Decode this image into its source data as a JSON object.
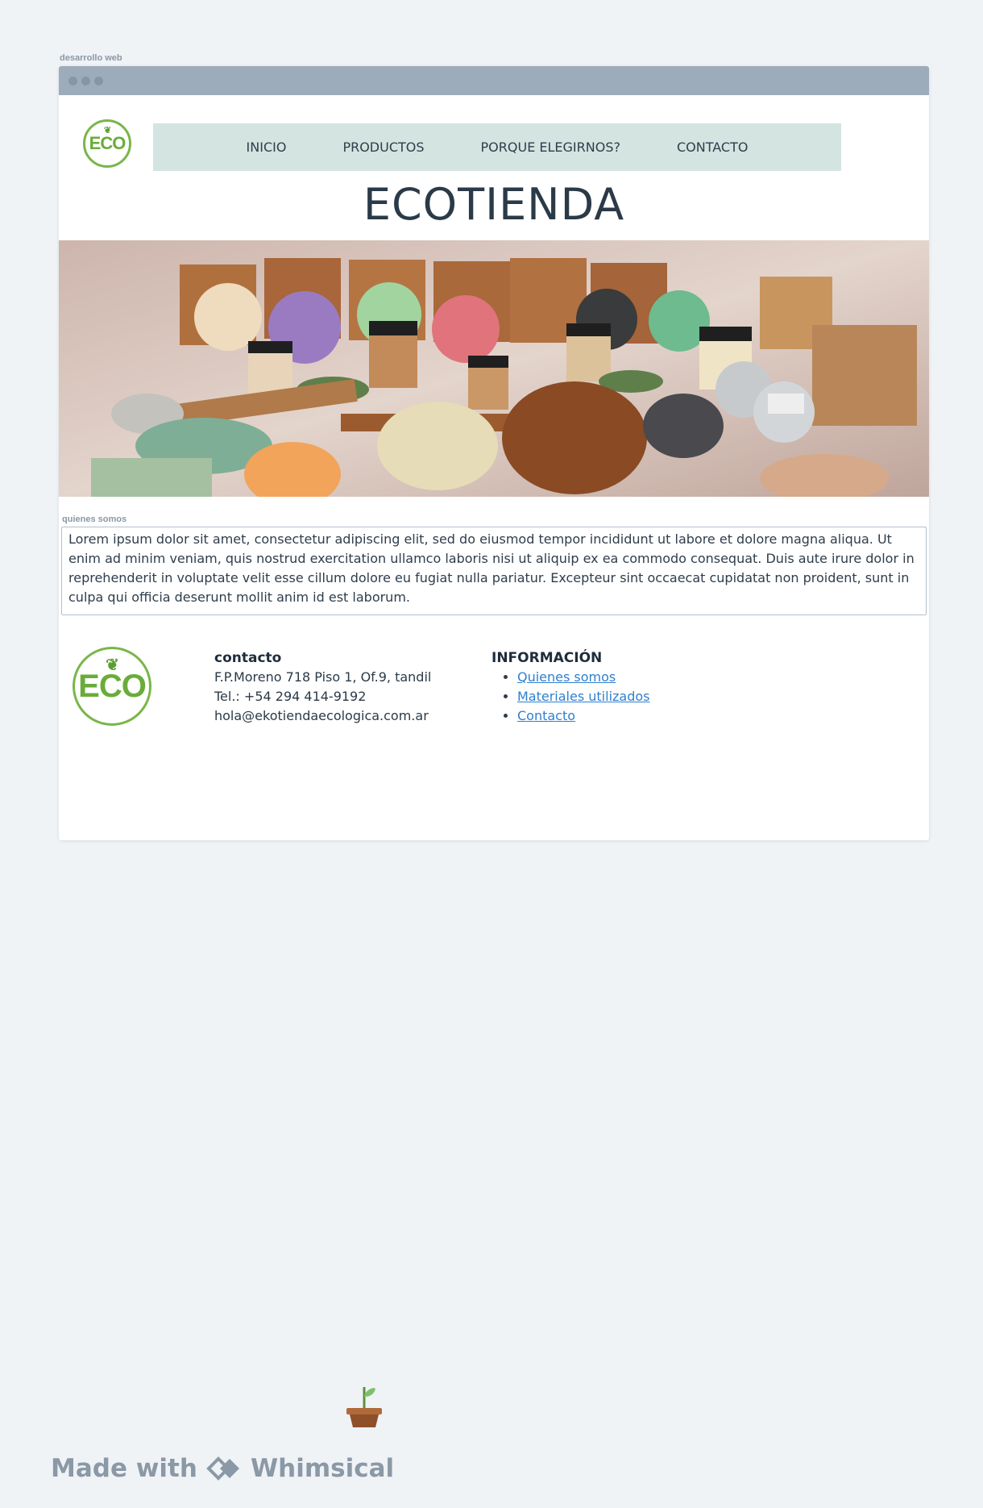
{
  "frame": {
    "label": "desarrollo web"
  },
  "header": {
    "logo_text": "ECO",
    "nav": [
      "INICIO",
      "PRODUCTOS",
      "PORQUE ELEGIRNOS?",
      "CONTACTO"
    ],
    "title": "ECOTIENDA"
  },
  "about": {
    "label": "quienes somos",
    "text": "Lorem ipsum dolor sit amet, consectetur adipiscing elit, sed do eiusmod tempor incididunt ut labore et dolore magna aliqua. Ut enim ad minim veniam, quis nostrud exercitation ullamco laboris nisi ut aliquip ex ea commodo consequat. Duis aute irure dolor in reprehenderit in voluptate velit esse cillum dolore eu fugiat nulla pariatur. Excepteur sint occaecat cupidatat non proident, sunt in culpa qui officia deserunt mollit anim id est laborum."
  },
  "footer": {
    "logo_text": "ECO",
    "contact": {
      "title": "contacto",
      "address": "F.P.Moreno 718 Piso 1, Of.9, tandil",
      "phone": "Tel.: +54 294 414-9192",
      "email": "hola@ekotiendaecologica.com.ar"
    },
    "info": {
      "title": "INFORMACIÓN",
      "links": [
        "Quienes somos",
        "Materiales utilizados",
        "Contacto"
      ]
    }
  },
  "branding": {
    "made_with": "Made with",
    "brand": "Whimsical"
  }
}
